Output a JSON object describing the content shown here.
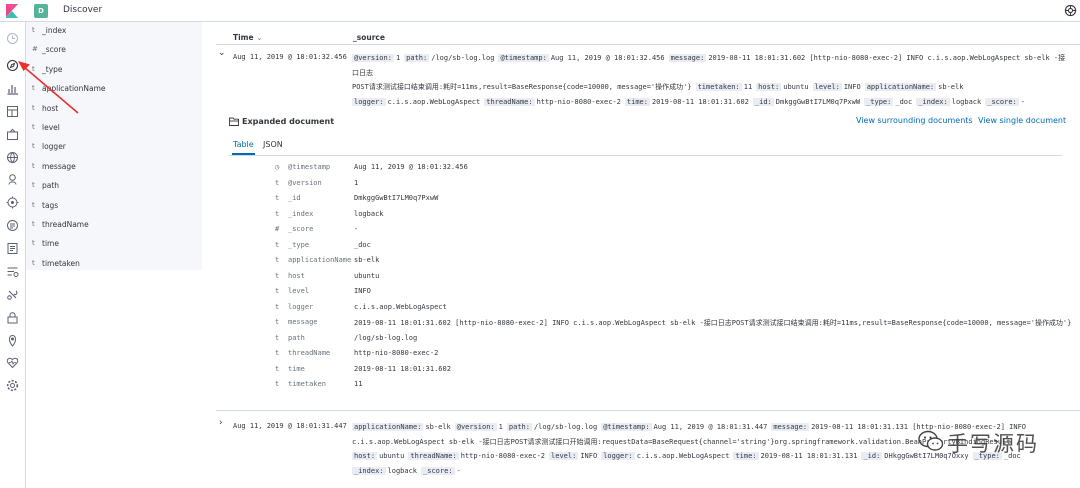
{
  "app": {
    "space_initial": "D",
    "title": "Discover"
  },
  "icons": {
    "logo": "kibana-logo-icon",
    "help": "help-icon",
    "nav": [
      "recently-viewed-icon",
      "discover-icon",
      "visualize-icon",
      "dashboard-icon",
      "canvas-icon",
      "maps-icon",
      "machine-learning-icon",
      "infrastructure-icon",
      "logs-icon",
      "apm-icon",
      "uptime-icon",
      "dev-tools-icon",
      "security-icon",
      "monitoring-icon",
      "management-icon"
    ]
  },
  "colors": {
    "accent": "#006bb4",
    "space_badge": "#54b399",
    "arrow": "#e8312f",
    "sidebar_bg": "#f5f7fa",
    "key_bg": "#e9edf3"
  },
  "fields": [
    {
      "type": "t",
      "name": "_index"
    },
    {
      "type": "#",
      "name": "_score"
    },
    {
      "type": "t",
      "name": "_type"
    },
    {
      "type": "t",
      "name": "applicationName"
    },
    {
      "type": "t",
      "name": "host"
    },
    {
      "type": "t",
      "name": "level"
    },
    {
      "type": "t",
      "name": "logger"
    },
    {
      "type": "t",
      "name": "message"
    },
    {
      "type": "t",
      "name": "path"
    },
    {
      "type": "t",
      "name": "tags"
    },
    {
      "type": "t",
      "name": "threadName"
    },
    {
      "type": "t",
      "name": "time"
    },
    {
      "type": "t",
      "name": "timetaken"
    }
  ],
  "table": {
    "col_time": "Time",
    "col_source": "_source",
    "rows": [
      {
        "expander": "⌄",
        "time": "Aug 11, 2019 @ 18:01:32.456",
        "source_lines": [
          [
            [
              "@version:",
              "1"
            ],
            [
              "path:",
              "/log/sb-log.log"
            ],
            [
              "@timestamp:",
              "Aug 11, 2019 @ 18:01:32.456"
            ],
            [
              "message:",
              "2019-08-11 18:01:31.602 [http-nio-8080-exec-2] INFO c.i.s.aop.WebLogAspect sb-elk -接口日志"
            ]
          ],
          [
            [
              "",
              "POST请求测试接口结束调用:耗时=11ms,result=BaseResponse{code=10000, message='操作成功'}"
            ],
            [
              "timetaken:",
              "11"
            ],
            [
              "host:",
              "ubuntu"
            ],
            [
              "level:",
              "INFO"
            ],
            [
              "applicationName:",
              "sb-elk"
            ]
          ],
          [
            [
              "logger:",
              "c.i.s.aop.WebLogAspect"
            ],
            [
              "threadName:",
              "http-nio-8080-exec-2"
            ],
            [
              "time:",
              "2019-08-11 18:01:31.602"
            ],
            [
              "_id:",
              "DmkggGwBtI7LM0q7PxwW"
            ],
            [
              "_type:",
              "_doc"
            ],
            [
              "_index:",
              "logback"
            ],
            [
              "_score:",
              "-"
            ]
          ]
        ]
      },
      {
        "expander": "›",
        "time": "Aug 11, 2019 @ 18:01:31.447",
        "source_lines": [
          [
            [
              "applicationName:",
              "sb-elk"
            ],
            [
              "@version:",
              "1"
            ],
            [
              "path:",
              "/log/sb-log.log"
            ],
            [
              "@timestamp:",
              "Aug 11, 2019 @ 18:01:31.447"
            ],
            [
              "message:",
              "2019-08-11 18:01:31.131 [http-nio-8080-exec-2] INFO"
            ]
          ],
          [
            [
              "",
              "c.i.s.aop.WebLogAspect sb-elk -接口日志POST请求测试接口开始调用:requestData=BaseRequest{channel='string'}org.springframework.validation.BeanPropertyBindingResult"
            ]
          ],
          [
            [
              "host:",
              "ubuntu"
            ],
            [
              "threadName:",
              "http-nio-8080-exec-2"
            ],
            [
              "level:",
              "INFO"
            ],
            [
              "logger:",
              "c.i.s.aop.WebLogAspect"
            ],
            [
              "time:",
              "2019-08-11 18:01:31.131"
            ],
            [
              "_id:",
              "DHkggGwBtI7LM0q7Oxxy"
            ],
            [
              "_type:",
              "_doc"
            ]
          ],
          [
            [
              "_index:",
              "logback"
            ],
            [
              "_score:",
              "-"
            ]
          ]
        ]
      }
    ]
  },
  "expanded": {
    "title": "Expanded document",
    "link_surrounding": "View surrounding documents",
    "link_single": "View single document",
    "tab_table": "Table",
    "tab_json": "JSON",
    "rows": [
      {
        "type": "◷",
        "key": "@timestamp",
        "value": "Aug 11, 2019 @ 18:01:32.456"
      },
      {
        "type": "t",
        "key": "@version",
        "value": "1"
      },
      {
        "type": "t",
        "key": "_id",
        "value": "DmkggGwBtI7LM0q7PxwW"
      },
      {
        "type": "t",
        "key": "_index",
        "value": "logback"
      },
      {
        "type": "#",
        "key": "_score",
        "value": " -"
      },
      {
        "type": "t",
        "key": "_type",
        "value": "_doc"
      },
      {
        "type": "t",
        "key": "applicationName",
        "value": "sb-elk"
      },
      {
        "type": "t",
        "key": "host",
        "value": "ubuntu"
      },
      {
        "type": "t",
        "key": "level",
        "value": "INFO"
      },
      {
        "type": "t",
        "key": "logger",
        "value": "c.i.s.aop.WebLogAspect"
      },
      {
        "type": "t",
        "key": "message",
        "value": "2019-08-11 18:01:31.602 [http-nio-8080-exec-2] INFO  c.i.s.aop.WebLogAspect sb-elk -接口日志POST请求测试接口结束调用:耗时=11ms,result=BaseResponse{code=10000, message='操作成功'}"
      },
      {
        "type": "t",
        "key": "path",
        "value": "/log/sb-log.log"
      },
      {
        "type": "t",
        "key": "threadName",
        "value": "http-nio-8080-exec-2"
      },
      {
        "type": "t",
        "key": "time",
        "value": "2019-08-11 18:01:31.602"
      },
      {
        "type": "t",
        "key": "timetaken",
        "value": "11"
      }
    ]
  },
  "watermark": {
    "text": "手写源码",
    "icon": "wechat-bubble-icon"
  }
}
